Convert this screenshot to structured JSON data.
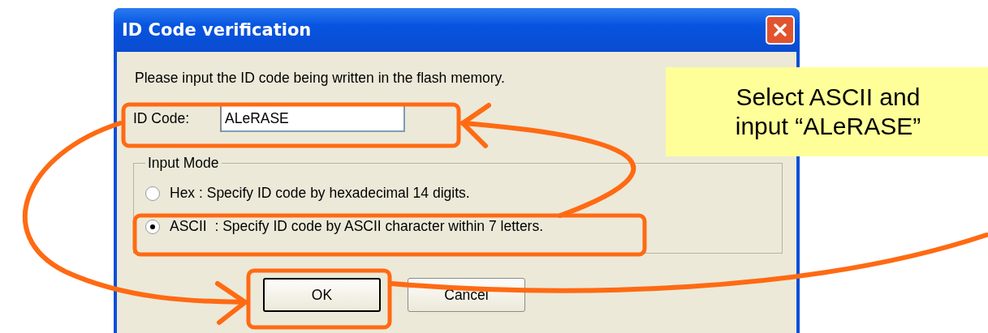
{
  "window": {
    "title": "ID Code verification"
  },
  "prompt": "Please input the ID code being written in the flash memory.",
  "id_code": {
    "label": "ID Code:",
    "value": "ALeRASE"
  },
  "input_mode": {
    "legend": "Input Mode",
    "options": [
      {
        "label": "Hex : Specify ID code by hexadecimal 14 digits.",
        "selected": false
      },
      {
        "label": "ASCII  : Specify ID code by ASCII character within 7 letters.",
        "selected": true
      }
    ]
  },
  "buttons": [
    {
      "label": "OK",
      "default": true
    },
    {
      "label": "Cancel",
      "default": false
    }
  ],
  "callout": {
    "lines": [
      "Select ASCII and",
      "input “ALeRASE”"
    ]
  }
}
